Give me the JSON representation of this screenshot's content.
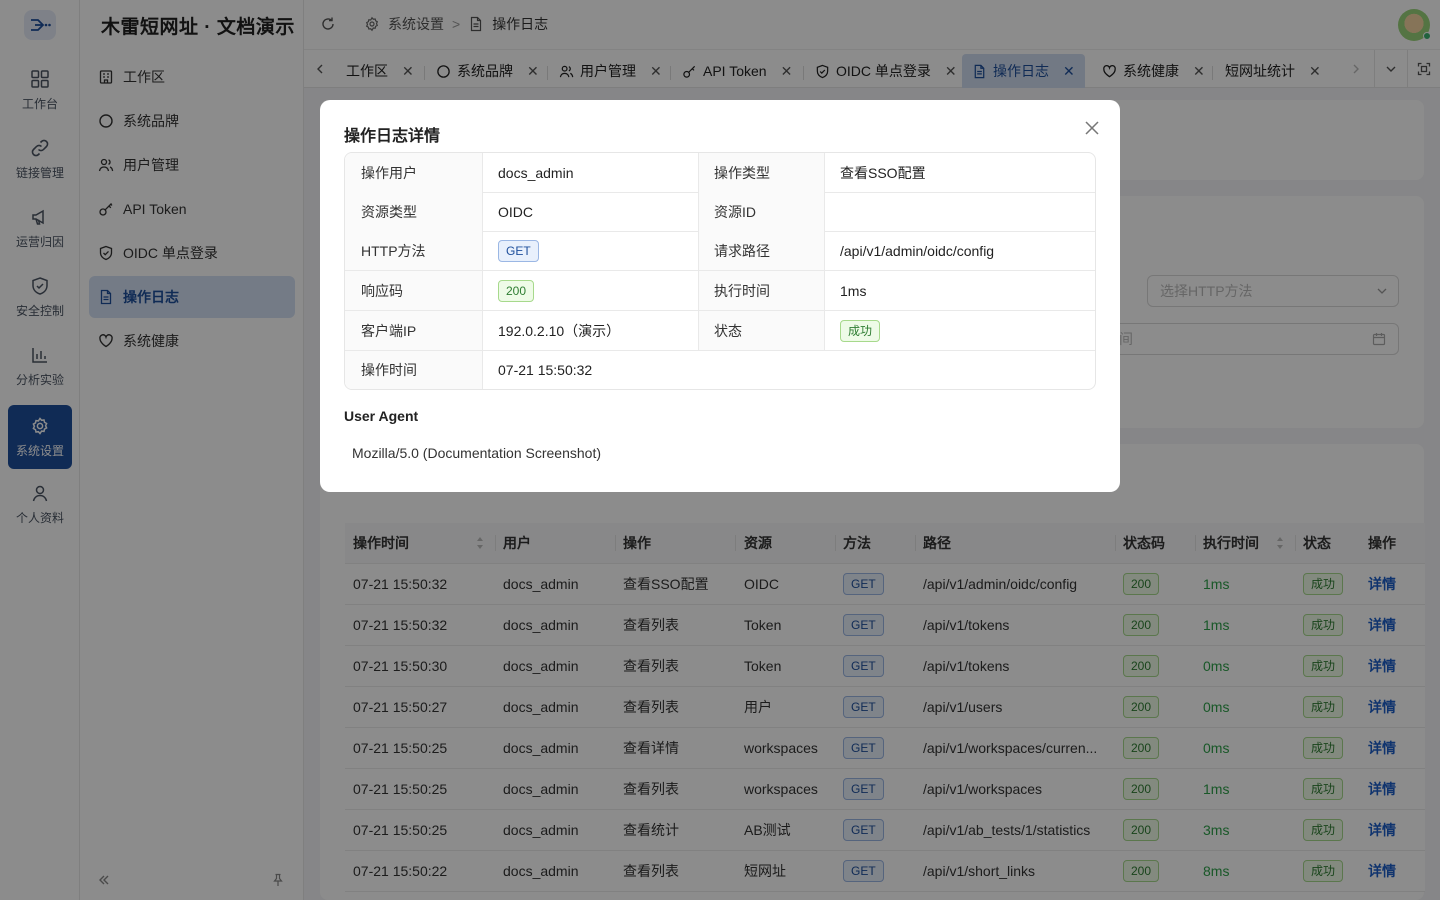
{
  "app": {
    "title": "木雷短网址 · 文档演示"
  },
  "rail": [
    {
      "label": "工作台",
      "icon": "dashboard-icon"
    },
    {
      "label": "链接管理",
      "icon": "link-icon"
    },
    {
      "label": "运营归因",
      "icon": "megaphone-icon"
    },
    {
      "label": "安全控制",
      "icon": "shield-icon"
    },
    {
      "label": "分析实验",
      "icon": "chart-icon"
    },
    {
      "label": "系统设置",
      "icon": "gear-icon",
      "active": true
    },
    {
      "label": "个人资料",
      "icon": "user-icon"
    }
  ],
  "menu": [
    {
      "label": "工作区",
      "icon": "building-icon"
    },
    {
      "label": "系统品牌",
      "icon": "circle-icon"
    },
    {
      "label": "用户管理",
      "icon": "users-icon"
    },
    {
      "label": "API Token",
      "icon": "key-icon"
    },
    {
      "label": "OIDC 单点登录",
      "icon": "shield-check-icon"
    },
    {
      "label": "操作日志",
      "icon": "document-icon",
      "active": true
    },
    {
      "label": "系统健康",
      "icon": "heart-icon"
    }
  ],
  "breadcrumb": {
    "parent": "系统设置",
    "current": "操作日志"
  },
  "tabs": [
    {
      "label": "工作区"
    },
    {
      "label": "系统品牌"
    },
    {
      "label": "用户管理"
    },
    {
      "label": "API Token"
    },
    {
      "label": "OIDC 单点登录"
    },
    {
      "label": "操作日志",
      "active": true
    },
    {
      "label": "系统健康"
    },
    {
      "label": "短网址统计"
    }
  ],
  "filters": {
    "method_placeholder": "选择HTTP方法",
    "date_fragment": "间"
  },
  "table": {
    "headers": [
      "操作时间",
      "用户",
      "操作",
      "资源",
      "方法",
      "路径",
      "状态码",
      "执行时间",
      "状态",
      "操作"
    ],
    "rows": [
      {
        "time": "07-21 15:50:32",
        "user": "docs_admin",
        "action": "查看SSO配置",
        "resource": "OIDC",
        "method": "GET",
        "path": "/api/v1/admin/oidc/config",
        "code": "200",
        "duration": "1ms",
        "status": "成功",
        "op": "详情"
      },
      {
        "time": "07-21 15:50:32",
        "user": "docs_admin",
        "action": "查看列表",
        "resource": "Token",
        "method": "GET",
        "path": "/api/v1/tokens",
        "code": "200",
        "duration": "1ms",
        "status": "成功",
        "op": "详情"
      },
      {
        "time": "07-21 15:50:30",
        "user": "docs_admin",
        "action": "查看列表",
        "resource": "Token",
        "method": "GET",
        "path": "/api/v1/tokens",
        "code": "200",
        "duration": "0ms",
        "status": "成功",
        "op": "详情"
      },
      {
        "time": "07-21 15:50:27",
        "user": "docs_admin",
        "action": "查看列表",
        "resource": "用户",
        "method": "GET",
        "path": "/api/v1/users",
        "code": "200",
        "duration": "0ms",
        "status": "成功",
        "op": "详情"
      },
      {
        "time": "07-21 15:50:25",
        "user": "docs_admin",
        "action": "查看详情",
        "resource": "workspaces",
        "method": "GET",
        "path": "/api/v1/workspaces/curren...",
        "code": "200",
        "duration": "0ms",
        "status": "成功",
        "op": "详情"
      },
      {
        "time": "07-21 15:50:25",
        "user": "docs_admin",
        "action": "查看列表",
        "resource": "workspaces",
        "method": "GET",
        "path": "/api/v1/workspaces",
        "code": "200",
        "duration": "1ms",
        "status": "成功",
        "op": "详情"
      },
      {
        "time": "07-21 15:50:25",
        "user": "docs_admin",
        "action": "查看统计",
        "resource": "AB测试",
        "method": "GET",
        "path": "/api/v1/ab_tests/1/statistics",
        "code": "200",
        "duration": "3ms",
        "status": "成功",
        "op": "详情"
      },
      {
        "time": "07-21 15:50:22",
        "user": "docs_admin",
        "action": "查看列表",
        "resource": "短网址",
        "method": "GET",
        "path": "/api/v1/short_links",
        "code": "200",
        "duration": "8ms",
        "status": "成功",
        "op": "详情"
      }
    ]
  },
  "modal": {
    "title": "操作日志详情",
    "fields": {
      "user_label": "操作用户",
      "user": "docs_admin",
      "type_label": "操作类型",
      "type": "查看SSO配置",
      "resource_type_label": "资源类型",
      "resource_type": "OIDC",
      "resource_id_label": "资源ID",
      "resource_id": "",
      "method_label": "HTTP方法",
      "method": "GET",
      "path_label": "请求路径",
      "path": "/api/v1/admin/oidc/config",
      "code_label": "响应码",
      "code": "200",
      "duration_label": "执行时间",
      "duration": "1ms",
      "ip_label": "客户端IP",
      "ip": "192.0.2.10（演示）",
      "status_label": "状态",
      "status": "成功",
      "time_label": "操作时间",
      "time": "07-21 15:50:32"
    },
    "ua_title": "User Agent",
    "ua_value": "Mozilla/5.0 (Documentation Screenshot)"
  },
  "colors": {
    "primary": "#1e4f9c",
    "success": "#2ea04a",
    "mask": "rgba(0,0,0,0.45)"
  }
}
